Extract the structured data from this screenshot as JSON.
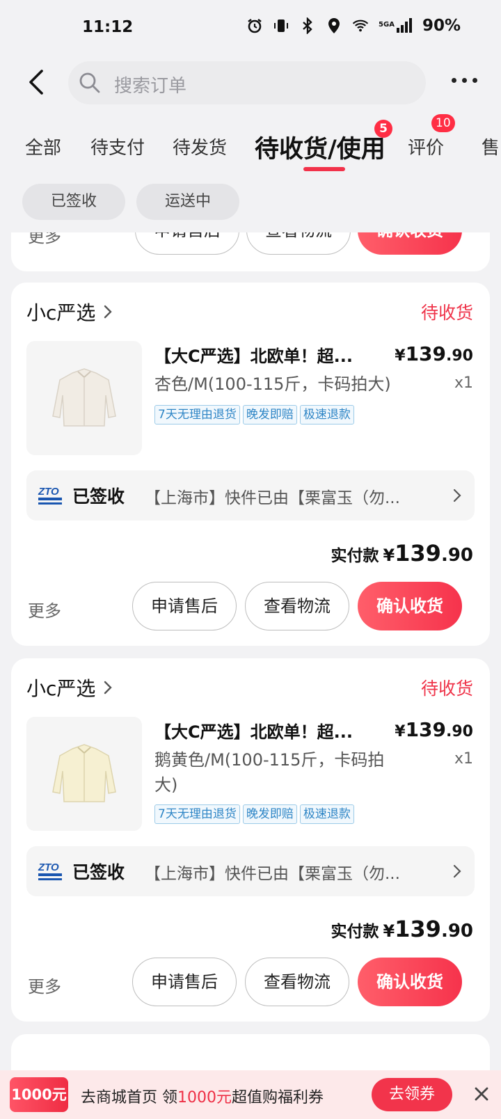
{
  "status_bar": {
    "time": "11:12",
    "network": "5GA",
    "battery": "90%"
  },
  "header": {
    "search_placeholder": "搜索订单"
  },
  "tabs": [
    {
      "label": "全部"
    },
    {
      "label": "待支付"
    },
    {
      "label": "待发货"
    },
    {
      "label": "待收货/使用",
      "badge": "5",
      "active": true
    },
    {
      "label": "评价",
      "badge": "10"
    },
    {
      "label": "售"
    }
  ],
  "filters": [
    {
      "label": "已签收"
    },
    {
      "label": "运送中"
    }
  ],
  "partial_card": {
    "more": "更多",
    "buttons": {
      "after_sale": "申请售后",
      "logistics": "查看物流",
      "confirm": "确认收货"
    }
  },
  "orders": [
    {
      "shop": "小c严选",
      "status": "待收货",
      "product_name": "【大C严选】北欧单！超...",
      "price": {
        "symbol": "¥",
        "int": "139",
        "dec": ".90"
      },
      "spec": "杏色/M(100-115斤，卡码拍大)",
      "qty": "x1",
      "tags": [
        "7天无理由退货",
        "晚发即赔",
        "极速退款"
      ],
      "logistics": {
        "state": "已签收",
        "info": "【上海市】快件已由【栗富玉（勿..."
      },
      "paid": {
        "label": "实付款",
        "symbol": "¥",
        "int": "139",
        "dec": ".90"
      },
      "more": "更多",
      "buttons": {
        "after_sale": "申请售后",
        "logistics": "查看物流",
        "confirm": "确认收货"
      },
      "thumb_color": "#f1ece4"
    },
    {
      "shop": "小c严选",
      "status": "待收货",
      "product_name": "【大C严选】北欧单！超...",
      "price": {
        "symbol": "¥",
        "int": "139",
        "dec": ".90"
      },
      "spec": "鹅黄色/M(100-115斤，卡码拍大)",
      "qty": "x1",
      "tags": [
        "7天无理由退货",
        "晚发即赔",
        "极速退款"
      ],
      "logistics": {
        "state": "已签收",
        "info": "【上海市】快件已由【栗富玉（勿..."
      },
      "paid": {
        "label": "实付款",
        "symbol": "¥",
        "int": "139",
        "dec": ".90"
      },
      "more": "更多",
      "buttons": {
        "after_sale": "申请售后",
        "logistics": "查看物流",
        "confirm": "确认收货"
      },
      "thumb_color": "#f6f0d2"
    }
  ],
  "banner": {
    "coupon": "1000元",
    "text_prefix": "去商城首页 领",
    "text_amount": "1000元",
    "text_suffix": "超值购福利券",
    "cta": "去领券"
  },
  "colors": {
    "accent": "#f2324a",
    "tag_blue": "#2f86c6"
  }
}
